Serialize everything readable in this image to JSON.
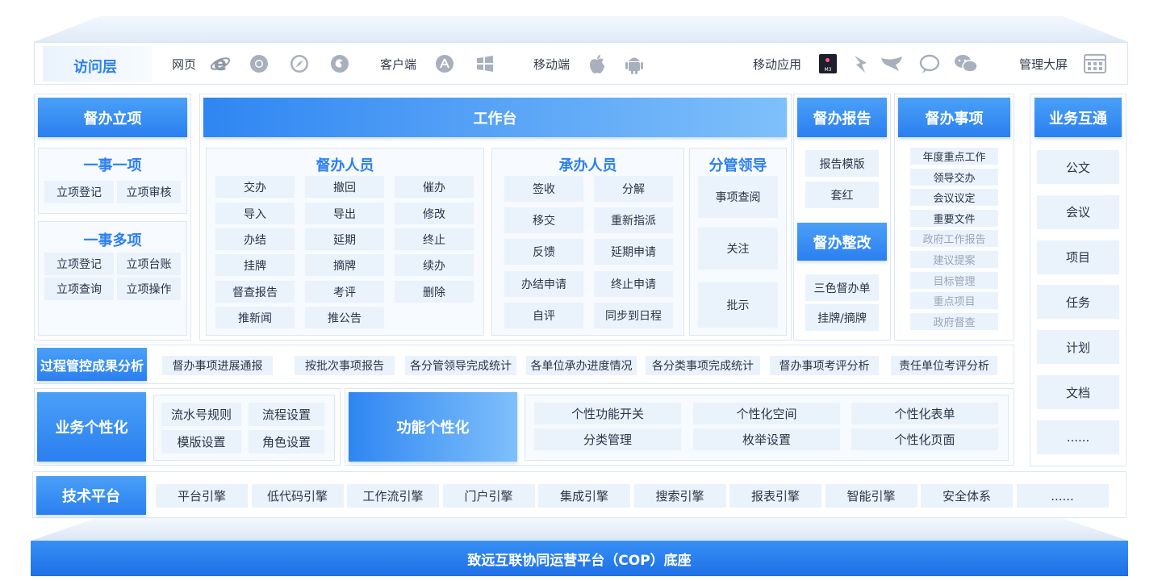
{
  "access": {
    "title": "访问层",
    "web": "网页",
    "client": "客户端",
    "mobile": "移动端",
    "mobile_app": "移动应用",
    "big_screen": "管理大屏",
    "m3_badge": "M3"
  },
  "project": {
    "title": "督办立项",
    "single": {
      "title": "一事一项",
      "items": [
        "立项登记",
        "立项审核"
      ]
    },
    "multi": {
      "title": "一事多项",
      "items": [
        "立项登记",
        "立项台账",
        "立项查询",
        "立项操作"
      ]
    }
  },
  "workbench": {
    "title": "工作台",
    "supervisors": {
      "title": "督办人员",
      "items": [
        "交办",
        "撤回",
        "催办",
        "导入",
        "导出",
        "修改",
        "办结",
        "延期",
        "终止",
        "挂牌",
        "摘牌",
        "续办",
        "督查报告",
        "考评",
        "删除",
        "推新闻",
        "推公告"
      ]
    },
    "undertakers": {
      "title": "承办人员",
      "items": [
        "签收",
        "分解",
        "移交",
        "重新指派",
        "反馈",
        "延期申请",
        "办结申请",
        "终止申请",
        "自评",
        "同步到日程"
      ]
    },
    "leaders": {
      "title": "分管领导",
      "items": [
        "事项查阅",
        "关注",
        "批示"
      ]
    }
  },
  "report": {
    "title": "督办报告",
    "items": [
      "报告模版",
      "套红"
    ]
  },
  "rectify": {
    "title": "督办整改",
    "items": [
      "三色督办单",
      "挂牌/摘牌"
    ]
  },
  "matters": {
    "title": "督办事项",
    "items": [
      "年度重点工作",
      "领导交办",
      "会议议定",
      "重要文件",
      "政府工作报告",
      "建议提案",
      "目标管理",
      "重点项目",
      "政府督查"
    ]
  },
  "interop": {
    "title": "业务互通",
    "items": [
      "公文",
      "会议",
      "项目",
      "任务",
      "计划",
      "文档",
      "......"
    ]
  },
  "analysis": {
    "title": "过程管控成果分析",
    "items": [
      "督办事项进展通报",
      "按批次事项报告",
      "各分管领导完成统计",
      "各单位承办进度情况",
      "各分类事项完成统计",
      "督办事项考评分析",
      "责任单位考评分析"
    ]
  },
  "biz_custom": {
    "title": "业务个性化",
    "items": [
      "流水号规则",
      "流程设置",
      "模版设置",
      "角色设置"
    ]
  },
  "func_custom": {
    "title": "功能个性化",
    "items": [
      "个性功能开关",
      "个性化空间",
      "个性化表单",
      "分类管理",
      "枚举设置",
      "个性化页面"
    ]
  },
  "tech": {
    "title": "技术平台",
    "items": [
      "平台引擎",
      "低代码引擎",
      "工作流引擎",
      "门户引擎",
      "集成引擎",
      "搜索引擎",
      "报表引擎",
      "智能引擎",
      "安全体系",
      "......"
    ]
  },
  "base": {
    "title": "致远互联协同运营平台（COP）底座"
  },
  "colors": {
    "accent": "#2b7ff0",
    "cell": "#eaf2fc",
    "title_text": "#2b7ff0"
  }
}
